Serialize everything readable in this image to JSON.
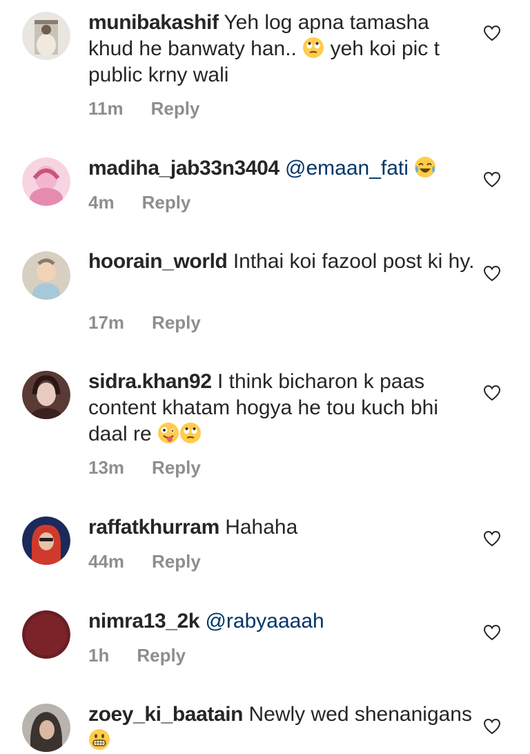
{
  "comments": [
    {
      "username": "munibakashif",
      "text_parts": [
        "Yeh log apna tamasha khud he banwaty han.. ",
        " yeh koi pic t public krny wali"
      ],
      "emoji": [
        "face-with-rolling-eyes"
      ],
      "time": "11m",
      "reply": "Reply",
      "avatar_colors": [
        "#c9c2b6",
        "#6d5e50"
      ]
    },
    {
      "username": "madiha_jab33n3404",
      "mention": "@emaan_fati",
      "emoji": [
        "face-with-tears-of-joy"
      ],
      "time": "4m",
      "reply": "Reply",
      "avatar_colors": [
        "#f3b6cc",
        "#e58bb0"
      ]
    },
    {
      "username": "hoorain_world",
      "text": "Inthai koi fazool post ki hy.",
      "time": "17m",
      "reply": "Reply",
      "avatar_colors": [
        "#d7cfc1",
        "#8f7b62"
      ]
    },
    {
      "username": "sidra.khan92",
      "text_parts": [
        "I think bicharon k paas content khatam hogya he tou kuch bhi daal re "
      ],
      "emoji": [
        "zany-face",
        "face-with-rolling-eyes"
      ],
      "time": "13m",
      "reply": "Reply",
      "avatar_colors": [
        "#e2c7c1",
        "#3a2220"
      ]
    },
    {
      "username": "raffatkhurram",
      "text": "Hahaha",
      "time": "44m",
      "reply": "Reply",
      "avatar_colors": [
        "#1b2a5a",
        "#d03a2c"
      ]
    },
    {
      "username": "nimra13_2k",
      "mention": "@rabyaaaah",
      "time": "1h",
      "reply": "Reply",
      "avatar_colors": [
        "#6a1e24",
        "#8a2a30"
      ]
    },
    {
      "username": "zoey_ki_baatain",
      "text_parts": [
        "Newly wed shenanigans "
      ],
      "emoji": [
        "grimacing-face"
      ],
      "avatar_colors": [
        "#b9b3ad",
        "#3b3330"
      ]
    }
  ]
}
